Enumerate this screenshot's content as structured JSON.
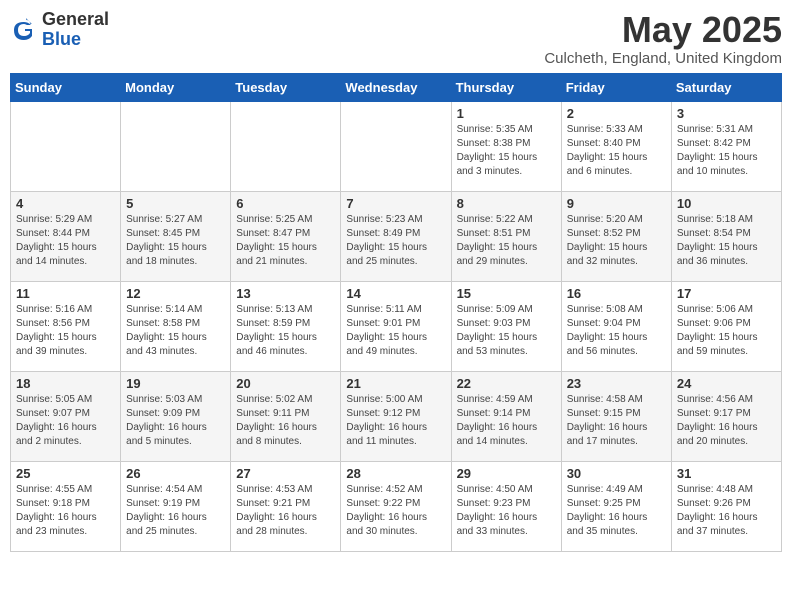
{
  "logo": {
    "general": "General",
    "blue": "Blue"
  },
  "header": {
    "month_year": "May 2025",
    "location": "Culcheth, England, United Kingdom"
  },
  "weekdays": [
    "Sunday",
    "Monday",
    "Tuesday",
    "Wednesday",
    "Thursday",
    "Friday",
    "Saturday"
  ],
  "weeks": [
    [
      {
        "day": "",
        "info": ""
      },
      {
        "day": "",
        "info": ""
      },
      {
        "day": "",
        "info": ""
      },
      {
        "day": "",
        "info": ""
      },
      {
        "day": "1",
        "info": "Sunrise: 5:35 AM\nSunset: 8:38 PM\nDaylight: 15 hours\nand 3 minutes."
      },
      {
        "day": "2",
        "info": "Sunrise: 5:33 AM\nSunset: 8:40 PM\nDaylight: 15 hours\nand 6 minutes."
      },
      {
        "day": "3",
        "info": "Sunrise: 5:31 AM\nSunset: 8:42 PM\nDaylight: 15 hours\nand 10 minutes."
      }
    ],
    [
      {
        "day": "4",
        "info": "Sunrise: 5:29 AM\nSunset: 8:44 PM\nDaylight: 15 hours\nand 14 minutes."
      },
      {
        "day": "5",
        "info": "Sunrise: 5:27 AM\nSunset: 8:45 PM\nDaylight: 15 hours\nand 18 minutes."
      },
      {
        "day": "6",
        "info": "Sunrise: 5:25 AM\nSunset: 8:47 PM\nDaylight: 15 hours\nand 21 minutes."
      },
      {
        "day": "7",
        "info": "Sunrise: 5:23 AM\nSunset: 8:49 PM\nDaylight: 15 hours\nand 25 minutes."
      },
      {
        "day": "8",
        "info": "Sunrise: 5:22 AM\nSunset: 8:51 PM\nDaylight: 15 hours\nand 29 minutes."
      },
      {
        "day": "9",
        "info": "Sunrise: 5:20 AM\nSunset: 8:52 PM\nDaylight: 15 hours\nand 32 minutes."
      },
      {
        "day": "10",
        "info": "Sunrise: 5:18 AM\nSunset: 8:54 PM\nDaylight: 15 hours\nand 36 minutes."
      }
    ],
    [
      {
        "day": "11",
        "info": "Sunrise: 5:16 AM\nSunset: 8:56 PM\nDaylight: 15 hours\nand 39 minutes."
      },
      {
        "day": "12",
        "info": "Sunrise: 5:14 AM\nSunset: 8:58 PM\nDaylight: 15 hours\nand 43 minutes."
      },
      {
        "day": "13",
        "info": "Sunrise: 5:13 AM\nSunset: 8:59 PM\nDaylight: 15 hours\nand 46 minutes."
      },
      {
        "day": "14",
        "info": "Sunrise: 5:11 AM\nSunset: 9:01 PM\nDaylight: 15 hours\nand 49 minutes."
      },
      {
        "day": "15",
        "info": "Sunrise: 5:09 AM\nSunset: 9:03 PM\nDaylight: 15 hours\nand 53 minutes."
      },
      {
        "day": "16",
        "info": "Sunrise: 5:08 AM\nSunset: 9:04 PM\nDaylight: 15 hours\nand 56 minutes."
      },
      {
        "day": "17",
        "info": "Sunrise: 5:06 AM\nSunset: 9:06 PM\nDaylight: 15 hours\nand 59 minutes."
      }
    ],
    [
      {
        "day": "18",
        "info": "Sunrise: 5:05 AM\nSunset: 9:07 PM\nDaylight: 16 hours\nand 2 minutes."
      },
      {
        "day": "19",
        "info": "Sunrise: 5:03 AM\nSunset: 9:09 PM\nDaylight: 16 hours\nand 5 minutes."
      },
      {
        "day": "20",
        "info": "Sunrise: 5:02 AM\nSunset: 9:11 PM\nDaylight: 16 hours\nand 8 minutes."
      },
      {
        "day": "21",
        "info": "Sunrise: 5:00 AM\nSunset: 9:12 PM\nDaylight: 16 hours\nand 11 minutes."
      },
      {
        "day": "22",
        "info": "Sunrise: 4:59 AM\nSunset: 9:14 PM\nDaylight: 16 hours\nand 14 minutes."
      },
      {
        "day": "23",
        "info": "Sunrise: 4:58 AM\nSunset: 9:15 PM\nDaylight: 16 hours\nand 17 minutes."
      },
      {
        "day": "24",
        "info": "Sunrise: 4:56 AM\nSunset: 9:17 PM\nDaylight: 16 hours\nand 20 minutes."
      }
    ],
    [
      {
        "day": "25",
        "info": "Sunrise: 4:55 AM\nSunset: 9:18 PM\nDaylight: 16 hours\nand 23 minutes."
      },
      {
        "day": "26",
        "info": "Sunrise: 4:54 AM\nSunset: 9:19 PM\nDaylight: 16 hours\nand 25 minutes."
      },
      {
        "day": "27",
        "info": "Sunrise: 4:53 AM\nSunset: 9:21 PM\nDaylight: 16 hours\nand 28 minutes."
      },
      {
        "day": "28",
        "info": "Sunrise: 4:52 AM\nSunset: 9:22 PM\nDaylight: 16 hours\nand 30 minutes."
      },
      {
        "day": "29",
        "info": "Sunrise: 4:50 AM\nSunset: 9:23 PM\nDaylight: 16 hours\nand 33 minutes."
      },
      {
        "day": "30",
        "info": "Sunrise: 4:49 AM\nSunset: 9:25 PM\nDaylight: 16 hours\nand 35 minutes."
      },
      {
        "day": "31",
        "info": "Sunrise: 4:48 AM\nSunset: 9:26 PM\nDaylight: 16 hours\nand 37 minutes."
      }
    ]
  ]
}
